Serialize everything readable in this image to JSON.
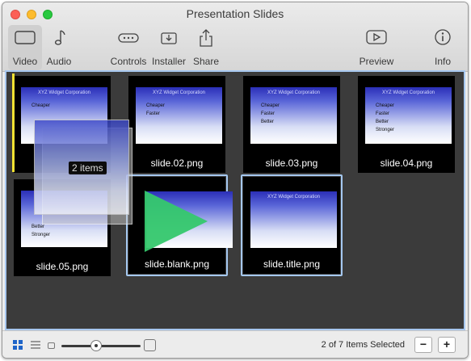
{
  "window": {
    "title": "Presentation Slides"
  },
  "toolbar": {
    "video": "Video",
    "audio": "Audio",
    "controls": "Controls",
    "installer": "Installer",
    "share": "Share",
    "preview": "Preview",
    "info": "Info"
  },
  "slides": [
    {
      "file": "slide.01.png",
      "heading": "XYZ Widget Corporation",
      "bullets": [
        "Cheaper"
      ]
    },
    {
      "file": "slide.02.png",
      "heading": "XYZ Widget Corporation",
      "bullets": [
        "Cheaper",
        "Faster"
      ]
    },
    {
      "file": "slide.03.png",
      "heading": "XYZ Widget Corporation",
      "bullets": [
        "Cheaper",
        "Faster",
        "Better"
      ]
    },
    {
      "file": "slide.04.png",
      "heading": "XYZ Widget Corporation",
      "bullets": [
        "Cheaper",
        "Faster",
        "Better",
        "Stronger"
      ]
    },
    {
      "file": "slide.05.png",
      "heading": "",
      "bullets": [
        "Better",
        "Stronger"
      ]
    },
    {
      "file": "slide.blank.png",
      "heading": "",
      "bullets": []
    },
    {
      "file": "slide.title.png",
      "heading": "XYZ Widget Corporation",
      "bullets": []
    }
  ],
  "drag": {
    "badge": "2 items"
  },
  "bottom": {
    "status": "2 of 7 Items Selected",
    "minus": "−",
    "plus": "+"
  },
  "colors": {
    "accent": "#a5c8f0",
    "play": "#35c86d"
  }
}
